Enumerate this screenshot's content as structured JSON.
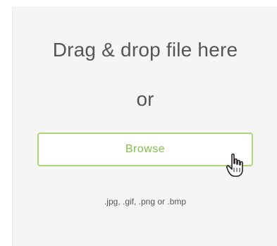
{
  "dropzone": {
    "title": "Drag & drop file here",
    "or_text": "or",
    "browse_label": "Browse",
    "formats_hint": ".jpg, .gif, .png or .bmp"
  },
  "colors": {
    "panel_background": "#f5f5f5",
    "title_text": "#555555",
    "button_border": "#a8d87a",
    "button_text": "#7fbf4a"
  },
  "icons": {
    "cursor": "hand-pointer-icon"
  }
}
